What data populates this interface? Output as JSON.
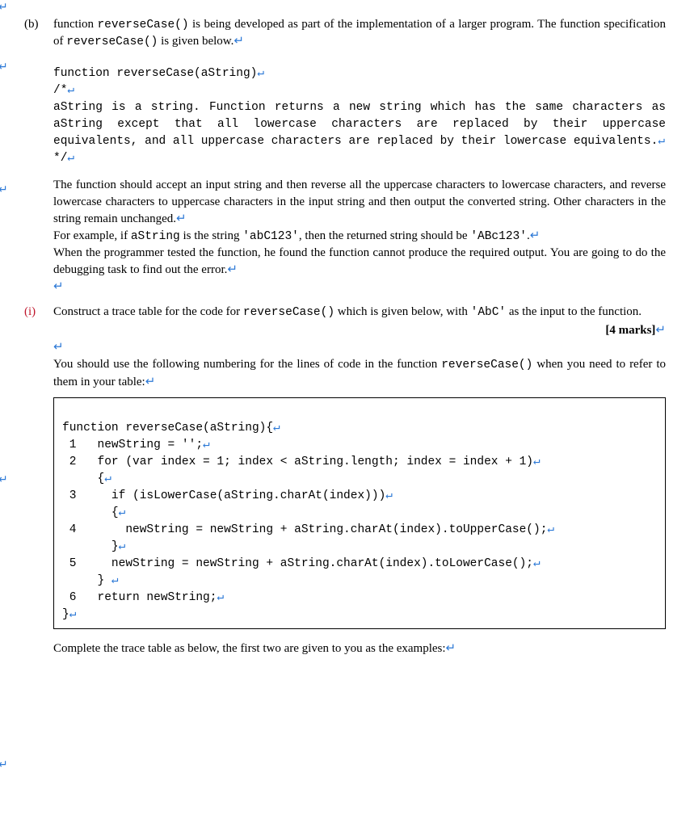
{
  "top_marker": "↵",
  "b": {
    "label": "(b)",
    "line1a": "function ",
    "line1b": "reverseCase()",
    "line1c": " is being developed as part of the implementation of a larger program. The function specification of ",
    "line1d": "reverseCase()",
    "line1e": " is given below.",
    "line1_ret": "↵"
  },
  "spec": {
    "l1": "function reverseCase(aString)",
    "l1_ret": "↵",
    "l2": "/*",
    "l2_ret": "↵",
    "body": " aString is a string. Function returns a new string which has the same  characters as aString except that all lowercase characters are replaced by their uppercase equivalents, and all uppercase characters are replaced by their lowercase equivalents.",
    "body_ret": "↵",
    "l3": "*/",
    "l3_ret": "↵"
  },
  "mid_marker": "↵",
  "desc": {
    "p1a": "The function should accept an input string and then reverse all the uppercase characters to lowercase characters, and reverse lowercase characters to uppercase characters in the input string and then output the converted string. Other characters in the string remain unchanged.",
    "p1_ret": "↵",
    "p2a": "For example, if ",
    "p2b": "aString",
    "p2c": " is the string ",
    "p2d": "'abC123'",
    "p2e": ", then the returned string should be ",
    "p3a": "'ABc123'",
    "p3b": ".",
    "p3_ret": "↵",
    "p4": "When the programmer tested the function, he found the function cannot produce the required output. You are going to do the debugging task to find out the error.",
    "p4_ret": "↵",
    "p5_ret": "↵"
  },
  "i": {
    "label": "(i)",
    "line1a": "Construct a trace table for the code for ",
    "line1b": "reverseCase()",
    "line1c": " which is given below, with ",
    "line1d": "'AbC'",
    "line1e": " as the input to the function.",
    "marks": "[4 marks]",
    "marks_ret": "↵",
    "ret1": "↵",
    "use1": "You should use the following numbering for the lines of code in the function ",
    "use2": "reverseCase()",
    "use3": " when you need to refer to them in your table:",
    "use_ret": "↵"
  },
  "left_marker2": "↵",
  "code": {
    "l0": "function reverseCase(aString){",
    "r0": "↵",
    "l1": " 1   newString = '';",
    "r1": "↵",
    "l2": " 2   for (var index = 1; index < aString.length; index = index + 1)",
    "r2": "↵",
    "l3": "     {",
    "r3": "↵",
    "l4": " 3     if (isLowerCase(aString.charAt(index)))",
    "r4": "↵",
    "l5": "       {",
    "r5": "↵",
    "l6": " 4       newString = newString + aString.charAt(index).toUpperCase();",
    "r6": "↵",
    "l7": "       }",
    "r7": "↵",
    "l8": " 5     newString = newString + aString.charAt(index).toLowerCase();",
    "r8": "↵",
    "l9": "     } ",
    "r9": "↵",
    "l10": " 6   return newString;",
    "r10": "↵",
    "l11": "}",
    "r11": "↵"
  },
  "bottom_marker": "↵",
  "complete": {
    "text": "Complete the trace table as below, the first two are given to you as the examples:",
    "ret": "↵"
  }
}
